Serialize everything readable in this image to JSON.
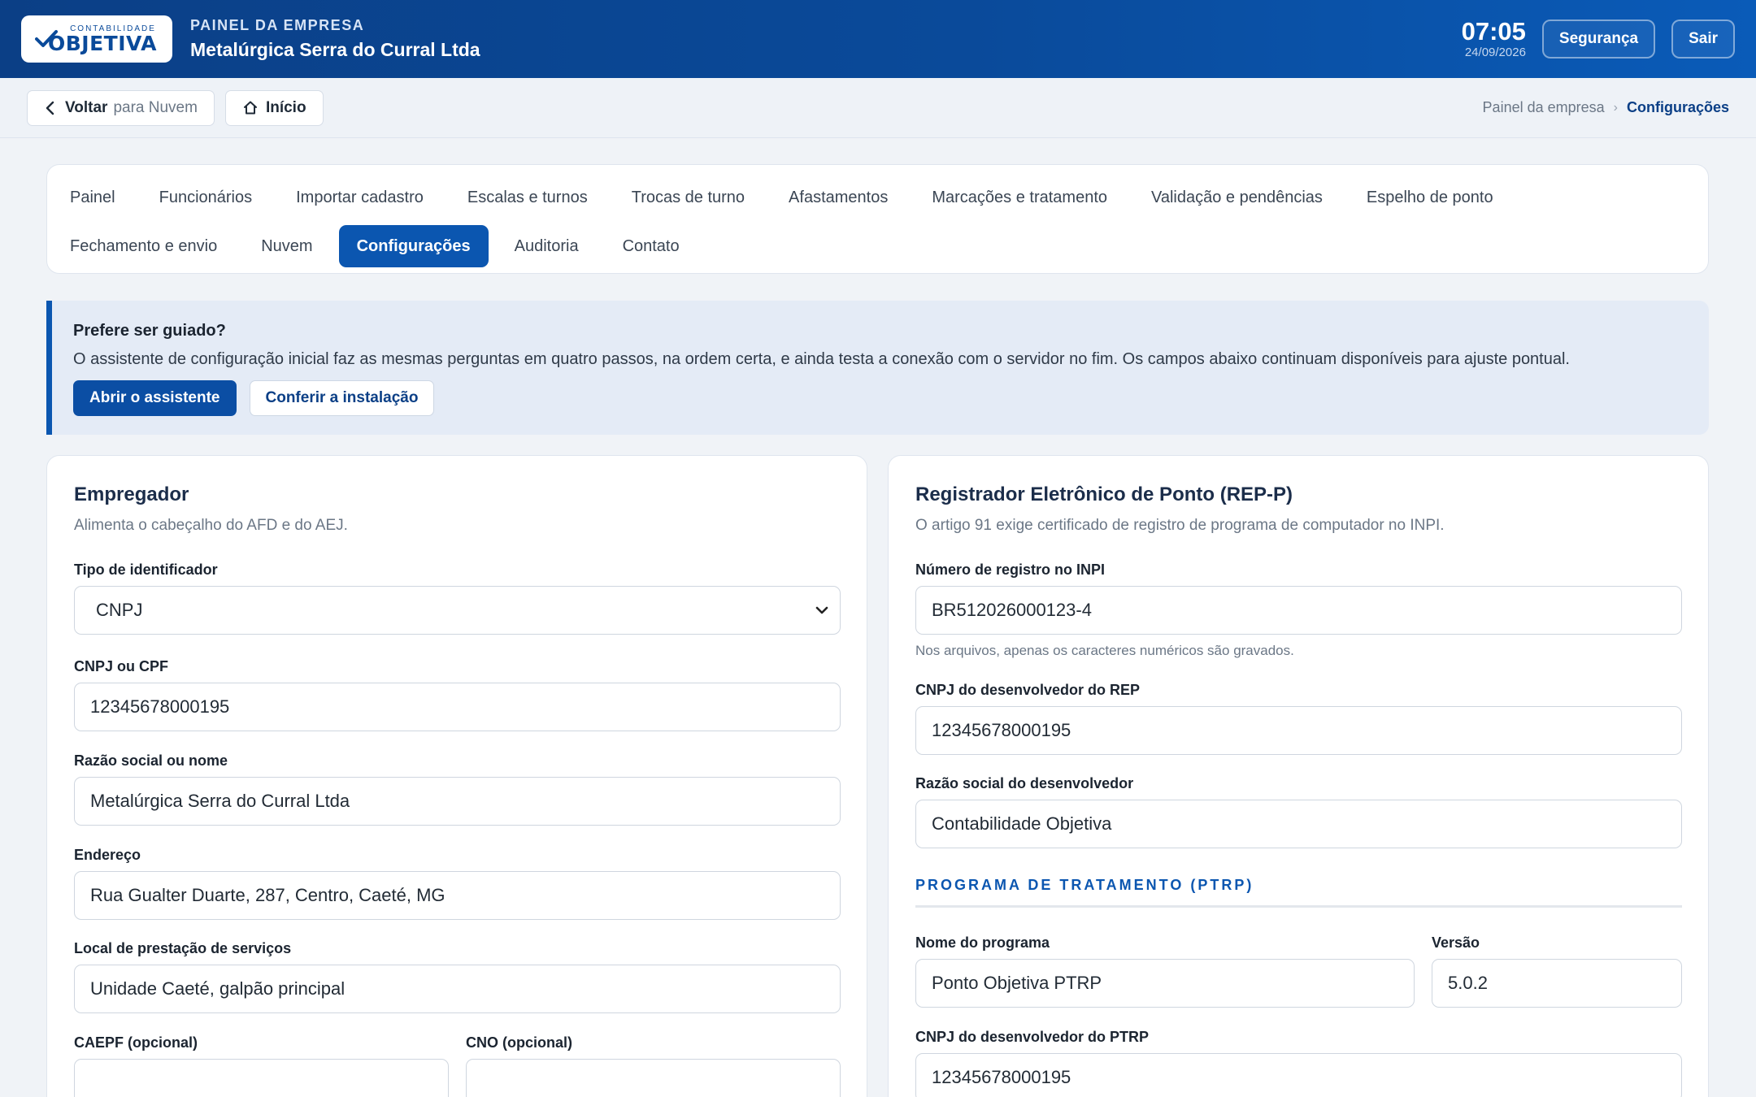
{
  "header": {
    "logo_small": "CONTABILIDADE",
    "logo_big": "OBJETIVA",
    "kicker": "PAINEL DA EMPRESA",
    "company": "Metalúrgica Serra do Curral Ltda",
    "time": "07:05",
    "date": "24/09/2026",
    "security_label": "Segurança",
    "logout_label": "Sair"
  },
  "navstrip": {
    "back_label": "Voltar",
    "back_suffix": "para Nuvem",
    "home_label": "Início",
    "breadcrumb": [
      "Painel da empresa",
      "Configurações"
    ]
  },
  "tabs": {
    "row1": [
      "Painel",
      "Funcionários",
      "Importar cadastro",
      "Escalas e turnos",
      "Trocas de turno",
      "Afastamentos",
      "Marcações e tratamento",
      "Validação e pendências",
      "Espelho de ponto"
    ],
    "row2": [
      "Fechamento e envio",
      "Nuvem",
      "Configurações",
      "Auditoria",
      "Contato"
    ],
    "active": "Configurações"
  },
  "guide": {
    "title": "Prefere ser guiado?",
    "text": "O assistente de configuração inicial faz as mesmas perguntas em quatro passos, na ordem certa, e ainda testa a conexão com o servidor no fim. Os campos abaixo continuam disponíveis para ajuste pontual.",
    "primary": "Abrir o assistente",
    "secondary": "Conferir a instalação"
  },
  "employer": {
    "title": "Empregador",
    "subtitle": "Alimenta o cabeçalho do AFD e do AEJ.",
    "id_type_label": "Tipo de identificador",
    "id_type_value": "CNPJ",
    "doc_label": "CNPJ ou CPF",
    "doc_value": "12345678000195",
    "name_label": "Razão social ou nome",
    "name_value": "Metalúrgica Serra do Curral Ltda",
    "address_label": "Endereço",
    "address_value": "Rua Gualter Duarte, 287, Centro, Caeté, MG",
    "site_label": "Local de prestação de serviços",
    "site_value": "Unidade Caeté, galpão principal",
    "caepf_label": "CAEPF (opcional)",
    "caepf_value": "",
    "cno_label": "CNO (opcional)",
    "cno_value": ""
  },
  "rep": {
    "title": "Registrador Eletrônico de Ponto (REP-P)",
    "subtitle": "O artigo 91 exige certificado de registro de programa de computador no INPI.",
    "inpi_label": "Número de registro no INPI",
    "inpi_value": "BR512026000123-4",
    "inpi_hint": "Nos arquivos, apenas os caracteres numéricos são gravados.",
    "dev_cnpj_label": "CNPJ do desenvolvedor do REP",
    "dev_cnpj_value": "12345678000195",
    "dev_name_label": "Razão social do desenvolvedor",
    "dev_name_value": "Contabilidade Objetiva",
    "ptrp_heading": "PROGRAMA DE TRATAMENTO (PTRP)",
    "program_label": "Nome do programa",
    "program_value": "Ponto Objetiva PTRP",
    "version_label": "Versão",
    "version_value": "5.0.2",
    "ptrp_cnpj_label": "CNPJ do desenvolvedor do PTRP",
    "ptrp_cnpj_value": "12345678000195"
  }
}
